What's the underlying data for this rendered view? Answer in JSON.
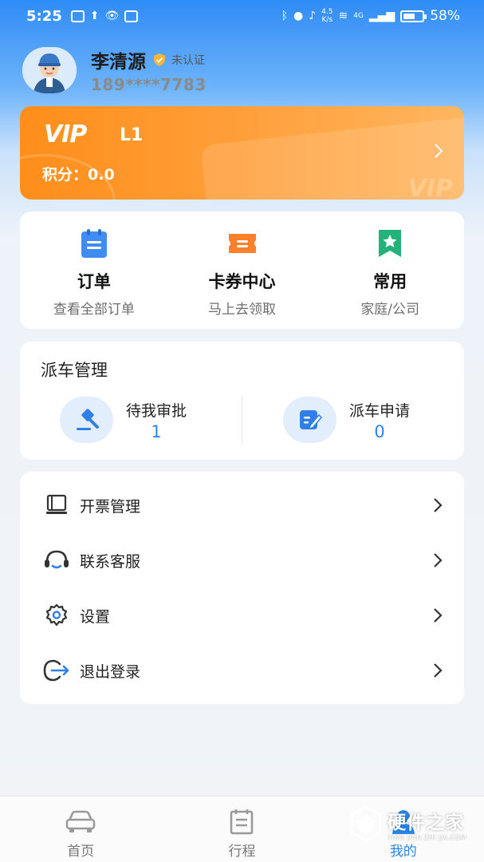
{
  "status_bar": {
    "time": "5:25",
    "net_speed_value": "4.5",
    "net_speed_unit": "K/s",
    "signal_label": "4G",
    "battery": "58%"
  },
  "profile": {
    "name": "李清源",
    "verify_status": "未认证",
    "phone": "189****7783"
  },
  "vip": {
    "logo": "VIP",
    "level": "L1",
    "points_label": "积分：",
    "points_value": "0.0",
    "watermark": "VIP"
  },
  "quick_actions": [
    {
      "title": "订单",
      "subtitle": "查看全部订单",
      "icon": "clipboard-icon",
      "color": "#3f8cf2"
    },
    {
      "title": "卡券中心",
      "subtitle": "马上去领取",
      "icon": "coupon-icon",
      "color": "#ff7f2a"
    },
    {
      "title": "常用",
      "subtitle": "家庭/公司",
      "icon": "bookmark-star-icon",
      "color": "#23b27a"
    }
  ],
  "dispatch": {
    "title": "派车管理",
    "pending_label": "待我审批",
    "pending_count": "1",
    "apply_label": "派车申请",
    "apply_count": "0"
  },
  "menu": [
    {
      "label": "开票管理",
      "icon": "invoice-icon"
    },
    {
      "label": "联系客服",
      "icon": "headset-icon"
    },
    {
      "label": "设置",
      "icon": "gear-icon"
    },
    {
      "label": "退出登录",
      "icon": "logout-icon"
    }
  ],
  "tabs": [
    {
      "label": "首页",
      "icon": "car-icon",
      "active": false
    },
    {
      "label": "行程",
      "icon": "calendar-icon",
      "active": false
    },
    {
      "label": "我的",
      "icon": "user-icon",
      "active": true
    }
  ],
  "watermark": {
    "main": "硬件之家",
    "sub": "YING JIAN ZHI JIA.COM"
  },
  "colors": {
    "primary": "#2a86e8",
    "vip_orange": "#ff9628"
  }
}
